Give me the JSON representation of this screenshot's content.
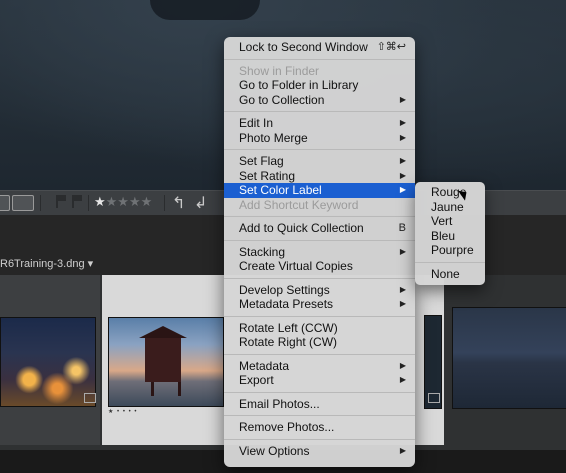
{
  "toolbar": {
    "rating_filled": "★",
    "rating_empty": "★★★★",
    "rotate_left_icon": "↰",
    "rotate_right_icon": "↲"
  },
  "filmstrip": {
    "filename": "R6Training-3.dng ▾",
    "mini_stars": "★ • • • •"
  },
  "menu": {
    "lock_second_window": "Lock to Second Window",
    "lock_shortcut": "⇧⌘↩",
    "show_in_finder": "Show in Finder",
    "go_to_folder": "Go to Folder in Library",
    "go_to_collection": "Go to Collection",
    "edit_in": "Edit In",
    "photo_merge": "Photo Merge",
    "set_flag": "Set Flag",
    "set_rating": "Set Rating",
    "set_color_label": "Set Color Label",
    "add_shortcut_keyword": "Add Shortcut Keyword",
    "add_quick_collection": "Add to Quick Collection",
    "quick_collection_shortcut": "B",
    "stacking": "Stacking",
    "create_virtual_copies": "Create Virtual Copies",
    "develop_settings": "Develop Settings",
    "metadata_presets": "Metadata Presets",
    "rotate_left": "Rotate Left (CCW)",
    "rotate_right": "Rotate Right (CW)",
    "metadata": "Metadata",
    "export": "Export",
    "email_photos": "Email Photos...",
    "remove_photos": "Remove Photos...",
    "view_options": "View Options",
    "arrow": "▶"
  },
  "submenu": {
    "rouge": "Rouge",
    "jaune": "Jaune",
    "vert": "Vert",
    "bleu": "Bleu",
    "pourpre": "Pourpre",
    "none": "None"
  }
}
